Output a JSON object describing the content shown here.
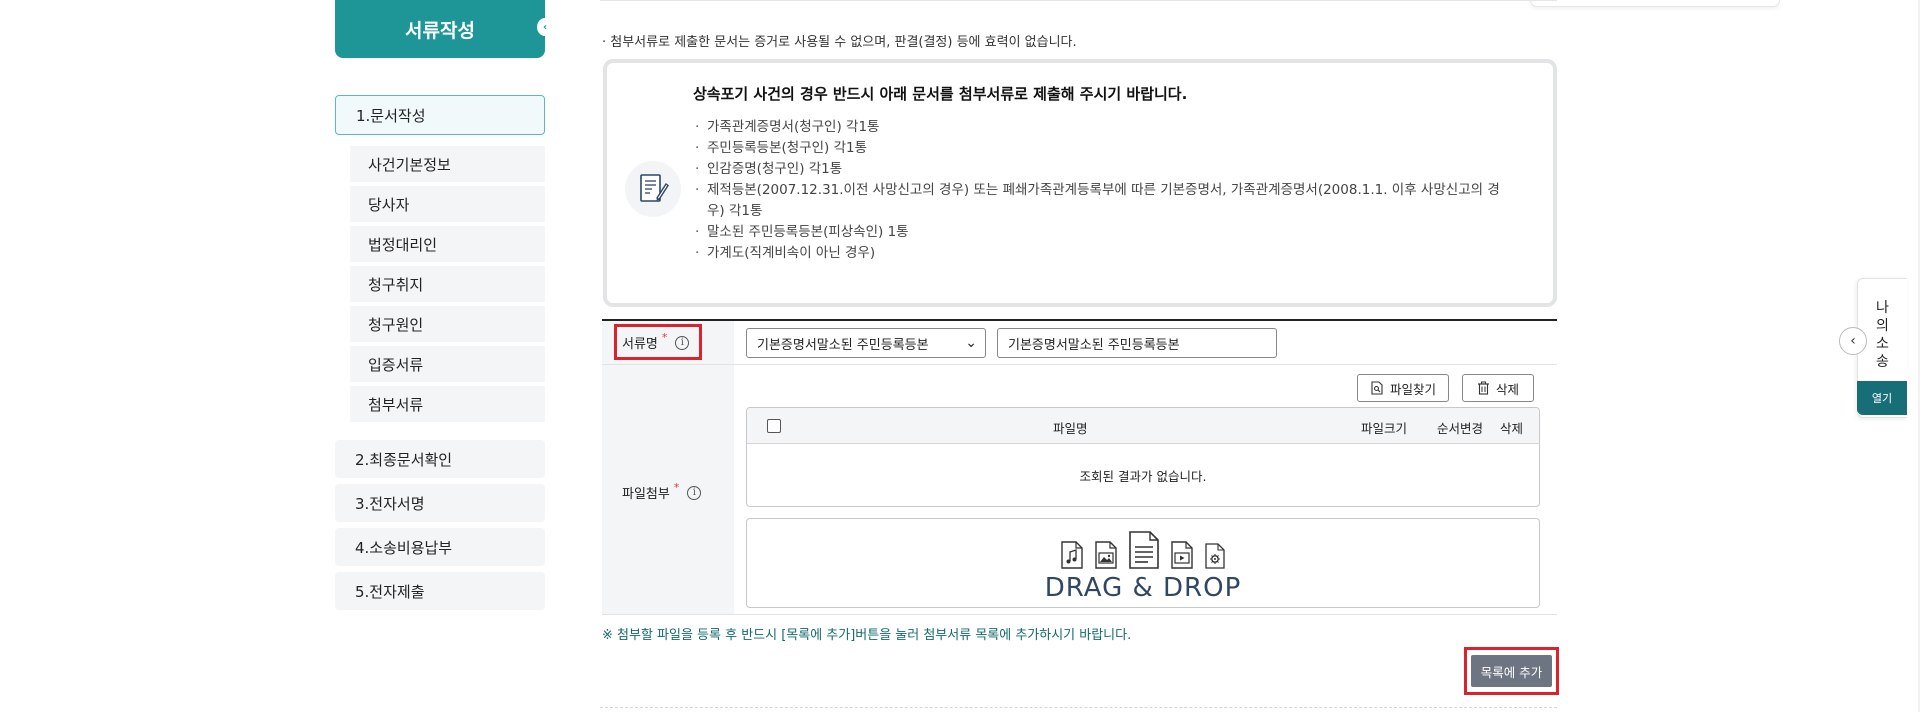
{
  "sidebar": {
    "header": "서류작성",
    "steps": [
      {
        "label": "1.문서작성"
      },
      {
        "label": "2.최종문서확인"
      },
      {
        "label": "3.전자서명"
      },
      {
        "label": "4.소송비용납부"
      },
      {
        "label": "5.전자제출"
      }
    ],
    "sub_items": [
      "사건기본정보",
      "당사자",
      "법정대리인",
      "청구취지",
      "청구원인",
      "입증서류",
      "첨부서류"
    ]
  },
  "notice": "· 첨부서류로 제출한 문서는 증거로 사용될 수 없으며, 판결(결정) 등에 효력이 없습니다.",
  "info": {
    "title": "상속포기 사건의 경우 반드시 아래 문서를 첨부서류로 제출해 주시기 바랍니다.",
    "items": [
      "가족관계증명서(청구인) 각1통",
      "주민등록등본(청구인) 각1통",
      "인감증명(청구인) 각1통",
      "제적등본(2007.12.31.이전 사망신고의 경우) 또는 폐쇄가족관계등록부에 따른 기본증명서, 가족관계증명서(2008.1.1. 이후 사망신고의 경우) 각1통",
      "말소된 주민등록등본(피상속인) 1통",
      "가계도(직계비속이 아닌 경우)"
    ]
  },
  "form": {
    "doc_name_label": "서류명",
    "doc_select_value": "기본증명서말소된 주민등록등본",
    "doc_text_value": "기본증명서말소된 주민등록등본",
    "file_attach_label": "파일첨부",
    "find_file_button": "파일찾기",
    "delete_button": "삭제",
    "table_headers": {
      "name": "파일명",
      "size": "파일크기",
      "order": "순서변경",
      "delete": "삭제"
    },
    "empty_message": "조회된 결과가 없습니다.",
    "dropzone_text": "DRAG & DROP",
    "hint": "※ 첨부할 파일을 등록 후 반드시 [목록에 추가]버튼을 눌러 첨부서류 목록에 추가하시기 바랍니다.",
    "add_button": "목록에 추가"
  },
  "dock": {
    "title": "나의소송",
    "open_button": "열기"
  },
  "colors": {
    "teal": "#1e9596",
    "dark_teal": "#176e77",
    "highlight_red": "#d9232f",
    "button_gray": "#6d7582"
  }
}
